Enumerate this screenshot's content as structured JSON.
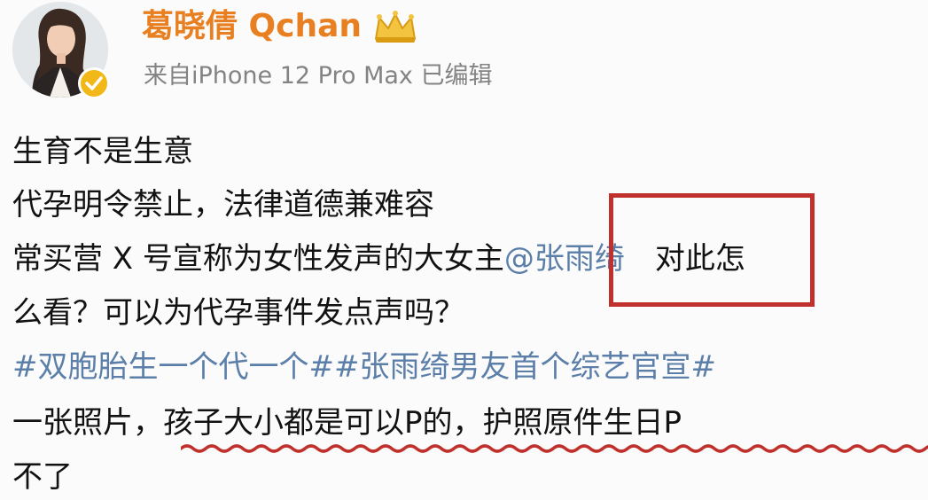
{
  "header": {
    "username": "葛晓倩 Qchan",
    "source_line": "来自iPhone 12 Pro Max  已编辑"
  },
  "post": {
    "line1": "生育不是生意",
    "line2": "代孕明令禁止，法律道德兼难容",
    "line3_before": "常买营 X 号宣称为女性发声的大女主",
    "mention": "@张雨绮",
    "line3_after": "对此怎",
    "line4": "么看？可以为代孕事件发点声吗？",
    "hashtags": "#双胞胎生一个代一个##张雨绮男友首个综艺官宣#",
    "line6": "一张照片，孩子大小都是可以P的，护照原件生日P",
    "line7": "不了"
  },
  "colors": {
    "username": "#e87f20",
    "link": "#5b7fa9",
    "annotation": "#c0302c",
    "badge": "#f2b818"
  },
  "icons": {
    "avatar": "profile-photo",
    "badge": "verified-check-icon",
    "crown": "vip-crown-icon"
  }
}
